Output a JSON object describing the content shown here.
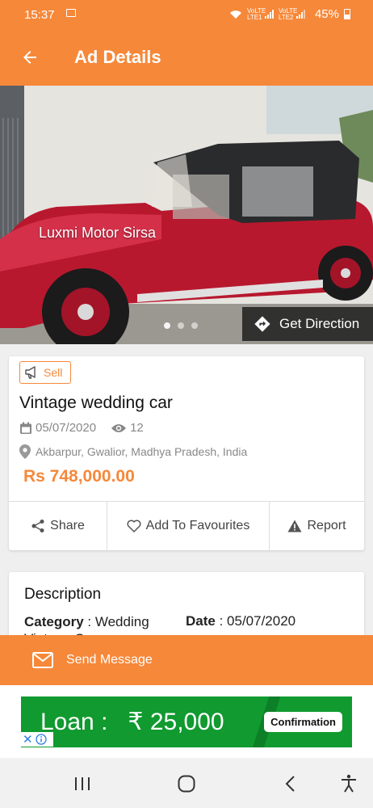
{
  "status_bar": {
    "time": "15:37",
    "sim1": "VoLTE LTE1",
    "sim2": "VoLTE LTE2",
    "battery": "45%"
  },
  "app_bar": {
    "title": "Ad Details"
  },
  "hero": {
    "caption": "Luxmi Motor Sirsa",
    "get_direction_label": "Get Direction",
    "dots": 3,
    "active_dot": 0
  },
  "ad": {
    "badge": "Sell",
    "title": "Vintage wedding car",
    "date": "05/07/2020",
    "views": "12",
    "location": "Akbarpur, Gwalior, Madhya Pradesh, India",
    "price": "Rs 748,000.00"
  },
  "actions": {
    "share": "Share",
    "favourites": "Add To Favourites",
    "report": "Report"
  },
  "description": {
    "heading": "Description",
    "category_label": "Category",
    "category_value": " : Wedding Vintage Cars",
    "date_label": "Date",
    "date_value": " : 05/07/2020"
  },
  "send_message": {
    "label": "Send Message"
  },
  "ad_banner": {
    "text": "Loan :   ₹ 25,000",
    "button": "Confirmation"
  },
  "colors": {
    "accent": "#f6883a",
    "banner_green": "#109a2f",
    "price": "#f6883a"
  },
  "icons": [
    "back-arrow-icon",
    "get-direction-icon",
    "megaphone-icon",
    "calendar-icon",
    "eye-icon",
    "location-pin-icon",
    "share-icon",
    "heart-icon",
    "warning-icon",
    "mail-icon",
    "ad-close-icon",
    "ad-info-icon",
    "recents-icon",
    "home-icon",
    "back-icon",
    "accessibility-icon"
  ]
}
